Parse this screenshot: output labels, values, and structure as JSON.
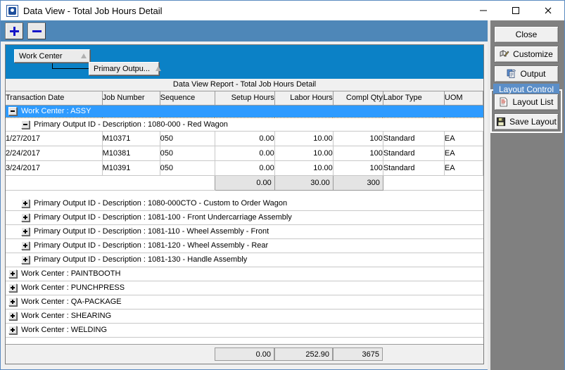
{
  "window": {
    "title": "Data View - Total Job Hours Detail",
    "icon": "app-dataview-icon",
    "minimize_label": "—",
    "maximize_label": "□",
    "close_label": "✕"
  },
  "toolbar": {
    "expand_all_label": "+",
    "collapse_all_label": "−"
  },
  "group_bar": {
    "boxes": [
      {
        "label": "Work Center",
        "sort": "ascending"
      },
      {
        "label": "Primary Outpu...",
        "sort": "ascending"
      }
    ]
  },
  "report": {
    "title": "Data View Report - Total Job Hours Detail",
    "columns": [
      {
        "label": "Transaction Date",
        "align": "left"
      },
      {
        "label": "Job Number",
        "align": "left"
      },
      {
        "label": "Sequence",
        "align": "left"
      },
      {
        "label": "Setup Hours",
        "align": "right"
      },
      {
        "label": "Labor Hours",
        "align": "right"
      },
      {
        "label": "Compl Qty",
        "align": "right"
      },
      {
        "label": "Labor Type",
        "align": "left"
      },
      {
        "label": "UOM",
        "align": "left"
      }
    ],
    "group_level1_expanded": "Work Center : ASSY",
    "group_level2_expanded": "Primary Output ID - Description : 1080-000 - Red Wagon",
    "rows": [
      {
        "date": "1/27/2017",
        "job": "M10371",
        "seq": "050",
        "setup": "0.00",
        "labor": "10.00",
        "qty": "100",
        "type": "Standard",
        "uom": "EA"
      },
      {
        "date": "2/24/2017",
        "job": "M10381",
        "seq": "050",
        "setup": "0.00",
        "labor": "10.00",
        "qty": "100",
        "type": "Standard",
        "uom": "EA"
      },
      {
        "date": "3/24/2017",
        "job": "M10391",
        "seq": "050",
        "setup": "0.00",
        "labor": "10.00",
        "qty": "100",
        "type": "Standard",
        "uom": "EA"
      }
    ],
    "subtotal": {
      "setup": "0.00",
      "labor": "30.00",
      "qty": "300"
    },
    "collapsed_level2": [
      "Primary Output ID - Description : 1080-000CTO - Custom to Order Wagon",
      "Primary Output ID - Description : 1081-100 - Front Undercarriage Assembly",
      "Primary Output ID - Description : 1081-110 - Wheel Assembly - Front",
      "Primary Output ID - Description : 1081-120 - Wheel Assembly - Rear",
      "Primary Output ID - Description : 1081-130 - Handle Assembly"
    ],
    "collapsed_level1": [
      "Work Center : PAINTBOOTH",
      "Work Center : PUNCHPRESS",
      "Work Center : QA-PACKAGE",
      "Work Center : SHEARING",
      "Work Center : WELDING"
    ],
    "grand_total": {
      "setup": "0.00",
      "labor": "252.90",
      "qty": "3675"
    }
  },
  "side_panel": {
    "close_label": "Close",
    "customize_label": "Customize",
    "output_label": "Output",
    "layout_control_label": "Layout Control",
    "layout_list_label": "Layout List",
    "save_layout_label": "Save Layout"
  },
  "colors": {
    "toolbar_blue": "#4e87b8",
    "group_bar_blue": "#0b81c6",
    "selected_row_blue": "#2e9bff",
    "panel_gray": "#808080",
    "group_label_blue": "#5b8ec8"
  }
}
